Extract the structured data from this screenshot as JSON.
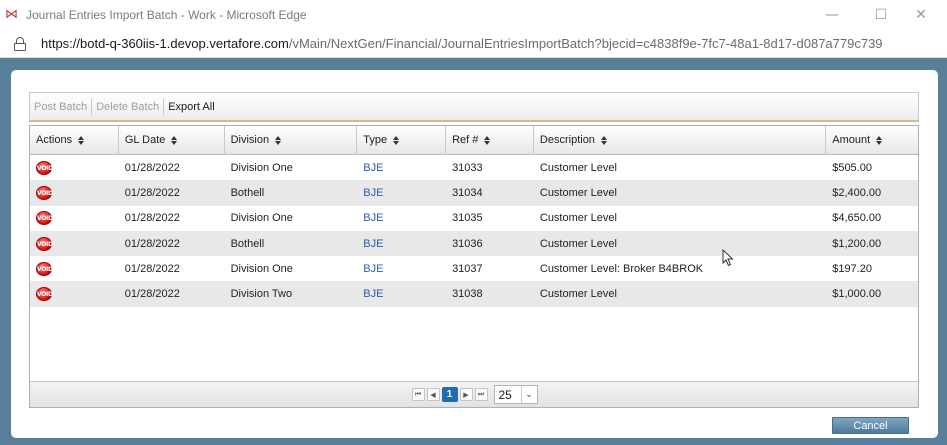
{
  "window": {
    "title": "Journal Entries Import Batch - Work - Microsoft Edge",
    "minimize_glyph": "—",
    "maximize_glyph": "☐",
    "close_glyph": "✕"
  },
  "address": {
    "host_part": "https://botd-q-360iis-1.devop.vertafore.com",
    "path_part": "/vMain/NextGen/Financial/JournalEntriesImportBatch?bjecid=c4838f9e-7fc7-48a1-8d17-d087a779c739"
  },
  "toolbar": {
    "post_batch": "Post Batch",
    "delete_batch": "Delete Batch",
    "export_all": "Export All"
  },
  "table": {
    "columns": [
      "Actions",
      "GL Date",
      "Division",
      "Type",
      "Ref #",
      "Description",
      "Amount"
    ],
    "action_icon_label": "VOID",
    "rows": [
      {
        "gl_date": "01/28/2022",
        "division": "Division One",
        "type": "BJE",
        "ref": "31033",
        "description": "Customer Level",
        "amount": "$505.00"
      },
      {
        "gl_date": "01/28/2022",
        "division": "Bothell",
        "type": "BJE",
        "ref": "31034",
        "description": "Customer Level",
        "amount": "$2,400.00"
      },
      {
        "gl_date": "01/28/2022",
        "division": "Division One",
        "type": "BJE",
        "ref": "31035",
        "description": "Customer Level",
        "amount": "$4,650.00"
      },
      {
        "gl_date": "01/28/2022",
        "division": "Bothell",
        "type": "BJE",
        "ref": "31036",
        "description": "Customer Level",
        "amount": "$1,200.00"
      },
      {
        "gl_date": "01/28/2022",
        "division": "Division One",
        "type": "BJE",
        "ref": "31037",
        "description": "Customer Level: Broker B4BROK",
        "amount": "$197.20"
      },
      {
        "gl_date": "01/28/2022",
        "division": "Division Two",
        "type": "BJE",
        "ref": "31038",
        "description": "Customer Level",
        "amount": "$1,000.00"
      }
    ]
  },
  "pager": {
    "first": "⏮",
    "prev": "◀",
    "current_page": "1",
    "next": "▶",
    "last": "⏭",
    "page_size": "25"
  },
  "footer": {
    "cancel": "Cancel"
  },
  "colors": {
    "backdrop": "#577f99",
    "link": "#2a5db0",
    "pager_current": "#1f6bb0",
    "void_icon": "#cc1111"
  }
}
